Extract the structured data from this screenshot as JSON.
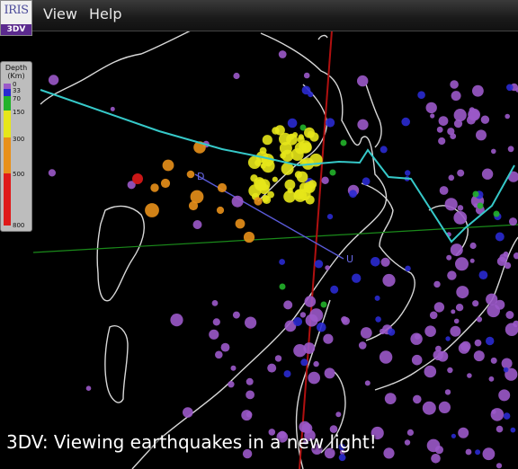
{
  "menu": {
    "view": "View",
    "help": "Help"
  },
  "logo": {
    "name": "IRIS",
    "product": "3DV"
  },
  "legend": {
    "title_line1": "Depth",
    "title_line2": "(Km)",
    "ticks": [
      "0",
      "33",
      "70",
      "150",
      "300",
      "500",
      "800"
    ],
    "colors": {
      "shallow": "#9b59c9",
      "d33": "#2a2ad0",
      "d70": "#22b22a",
      "d150": "#e6e61a",
      "d300": "#e8901a",
      "d500": "#e01a1a"
    }
  },
  "map": {
    "markers": {
      "d_label": "D",
      "u_label": "U"
    },
    "line_colors": {
      "coastline": "#d8d8d8",
      "trench": "#36c9c9",
      "meridian": "#b01010",
      "parallel": "#1a8a1a",
      "profile": "#5a5ad8"
    }
  },
  "caption": "3DV: Viewing earthquakes in a new light!"
}
